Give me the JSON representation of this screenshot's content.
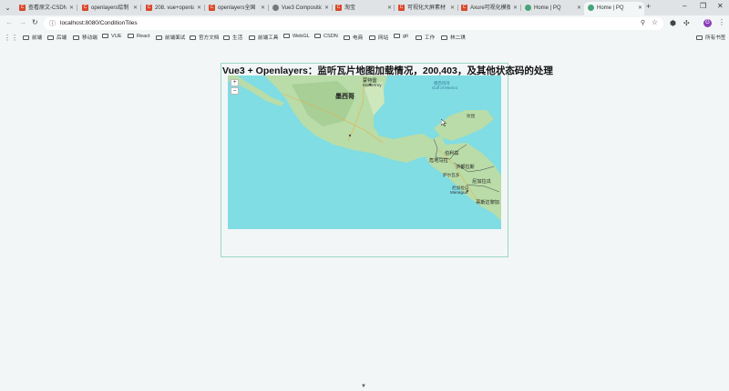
{
  "browser": {
    "tabs": [
      {
        "title": "查看原文-CSDN博客",
        "icon": "csdn-icon"
      },
      {
        "title": "openlayers绘制",
        "icon": "csdn-icon"
      },
      {
        "title": "208. vue+openlayers",
        "icon": "csdn-icon"
      },
      {
        "title": "openlayers全国",
        "icon": "csdn-icon"
      },
      {
        "title": "Vue3 Composition",
        "icon": "globe-icon"
      },
      {
        "title": "淘宝",
        "icon": "csdn-icon"
      },
      {
        "title": "可视化大屏素材",
        "icon": "csdn-icon"
      },
      {
        "title": "Axure可视化模板",
        "icon": "csdn-icon"
      },
      {
        "title": "Home | PQ",
        "icon": "leaf-icon"
      },
      {
        "title": "Home | PQ",
        "icon": "leaf-icon"
      }
    ],
    "active_tab": 9,
    "url": "localhost:8080/ConditionTiles",
    "bookmarks": [
      "前端",
      "后端",
      "移动端",
      "VUE",
      "React",
      "前端面试",
      "官方文档",
      "生活",
      "前端工具",
      "WebGL",
      "CSDN",
      "电商",
      "网站",
      "git",
      "工作",
      "林二琪"
    ],
    "all_bookmarks": "所有书签",
    "profile_initial": "G"
  },
  "page": {
    "title": "Vue3 + Openlayers：监听瓦片地图加载情况，200,403，及其他状态码的处理"
  },
  "map": {
    "zoom_in": "+",
    "zoom_out": "–",
    "labels": {
      "mexico": "墨西哥",
      "monterrey_cn": "蒙特雷",
      "monterrey": "Monterrey",
      "gulf": "墨西哥湾",
      "gulf_en": "Gulf of Mexico",
      "guatemala": "危地马拉",
      "honduras": "洪都拉斯",
      "belize": "伯利兹",
      "nicaragua": "尼加拉瓜",
      "managua": "Managua",
      "costa_rica": "哥斯达黎加",
      "cancun": "坎昆",
      "el_salvador": "萨尔瓦多"
    },
    "colors": {
      "water": "#7fdde3",
      "land": "#b9dca8"
    }
  }
}
